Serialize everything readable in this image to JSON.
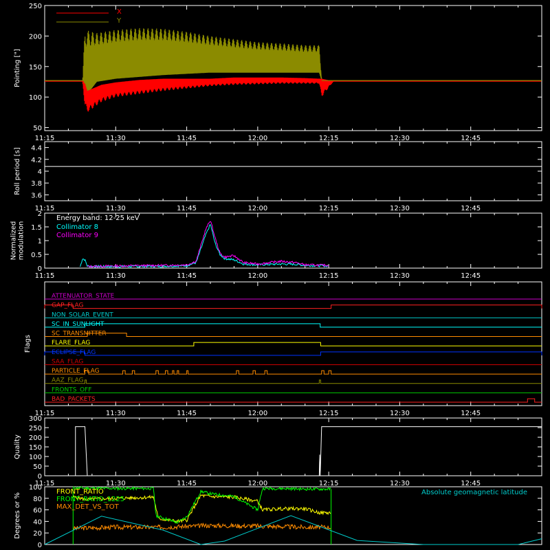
{
  "chart_data": [
    {
      "type": "line",
      "ylabel": "Pointing [\"]",
      "ylim": [
        45,
        250
      ],
      "yticks": [
        50,
        100,
        150,
        200,
        250
      ],
      "xticks": [
        "11:15",
        "11:30",
        "11:45",
        "12:00",
        "12:15",
        "12:30",
        "12:45"
      ],
      "xlim_minutes": [
        675,
        780
      ],
      "series": [
        {
          "name": "X",
          "color": "#ff0000",
          "x": [
            675,
            683,
            683.5,
            684,
            687,
            690,
            695,
            700,
            705,
            710,
            715,
            720,
            725,
            730,
            733,
            733.5,
            736,
            780
          ],
          "low": [
            126,
            126,
            85,
            75,
            92,
            100,
            105,
            110,
            114,
            118,
            120,
            121,
            122,
            122,
            122,
            100,
            126,
            126
          ],
          "high": [
            126,
            126,
            122,
            110,
            120,
            124,
            128,
            130,
            130,
            130,
            132,
            132,
            132,
            131,
            130,
            130,
            126,
            126
          ]
        },
        {
          "name": "Y",
          "color": "#8b8b00",
          "x": [
            675,
            683,
            683.5,
            686,
            690,
            695,
            700,
            705,
            710,
            715,
            720,
            725,
            730,
            733,
            733.5,
            780
          ],
          "low": [
            127,
            127,
            100,
            125,
            130,
            133,
            136,
            138,
            140,
            140,
            140,
            140,
            140,
            140,
            127,
            127
          ],
          "high": [
            127,
            127,
            210,
            205,
            210,
            213,
            212,
            207,
            200,
            195,
            190,
            188,
            185,
            185,
            127,
            127
          ]
        }
      ]
    },
    {
      "type": "line",
      "ylabel": "Roll period [s]",
      "ylim": [
        3.5,
        4.5
      ],
      "yticks": [
        3.6,
        3.8,
        4.0,
        4.2,
        4.4
      ],
      "series": [
        {
          "name": "",
          "color": "#ffffff",
          "x": [
            675,
            780
          ],
          "values": [
            4.08,
            4.08
          ]
        }
      ]
    },
    {
      "type": "line",
      "ylabel": "Normalized modulation",
      "ylim": [
        0,
        2.0
      ],
      "yticks": [
        0.0,
        0.5,
        1.0,
        1.5,
        2.0
      ],
      "annotation": "Energy band: 12-25 keV",
      "series": [
        {
          "name": "Collimator 8",
          "color": "#00ffff",
          "x": [
            682.5,
            683,
            683.5,
            684,
            685,
            690,
            700,
            705,
            707,
            709,
            710,
            711,
            712,
            713,
            715,
            717,
            720,
            725,
            728,
            730,
            735
          ],
          "values": [
            0.05,
            0.35,
            0.3,
            0.08,
            0.06,
            0.06,
            0.07,
            0.09,
            0.2,
            1.2,
            1.6,
            0.9,
            0.5,
            0.35,
            0.3,
            0.15,
            0.12,
            0.15,
            0.14,
            0.1,
            0.08
          ]
        },
        {
          "name": "Collimator 9",
          "color": "#ff00ff",
          "x": [
            684,
            690,
            700,
            705,
            707,
            709,
            710,
            711,
            712,
            713,
            715,
            717,
            720,
            725,
            728,
            730,
            735
          ],
          "values": [
            0.06,
            0.08,
            0.1,
            0.12,
            0.25,
            1.4,
            1.75,
            1.1,
            0.55,
            0.4,
            0.45,
            0.2,
            0.15,
            0.25,
            0.2,
            0.12,
            0.1
          ]
        }
      ]
    },
    {
      "type": "line",
      "ylabel": "Flags",
      "flags": [
        {
          "label": "ATTENUATOR_STATE",
          "color": "#cc00cc",
          "on": []
        },
        {
          "label": "GAP_FLAG",
          "color": "#ff2020",
          "on": [
            [
              675,
              681
            ],
            [
              735.5,
              780
            ]
          ]
        },
        {
          "label": "NON_SOLAR_EVENT",
          "color": "#00cccc",
          "on": []
        },
        {
          "label": "SC_IN_SUNLIGHT",
          "color": "#00ffff",
          "on": [
            [
              683.5,
              733.2
            ]
          ]
        },
        {
          "label": "SC_TRANSMITTER",
          "color": "#ff8c00",
          "on": [
            [
              684,
              692.3
            ]
          ]
        },
        {
          "label": "FLARE_FLAG",
          "color": "#ffff00",
          "on": [
            [
              706.5,
              733.3
            ]
          ]
        },
        {
          "label": "ECLIPSE_FLAG",
          "color": "#0033ff",
          "on": [
            [
              675,
              683.5
            ],
            [
              733.3,
              780
            ]
          ]
        },
        {
          "label": "SAA_FLAG",
          "color": "#cc0000",
          "on": []
        },
        {
          "label": "PARTICLE_FLAG",
          "color": "#ff8c00",
          "on": [
            [
              683.5,
              684.3
            ],
            [
              691.5,
              692
            ],
            [
              693.5,
              694
            ],
            [
              698.5,
              699
            ],
            [
              700.5,
              701
            ],
            [
              702,
              702.3
            ],
            [
              703,
              703.3
            ],
            [
              705,
              705.3
            ],
            [
              715.5,
              716
            ],
            [
              719,
              719.5
            ],
            [
              721.5,
              722
            ],
            [
              733.5,
              734
            ],
            [
              735,
              735.5
            ]
          ]
        },
        {
          "label": "AAZ_FLAG",
          "color": "#8b8b00",
          "on": [
            [
              683.5,
              683.8
            ],
            [
              733,
              733.3
            ]
          ]
        },
        {
          "label": "FRONTS_OFF",
          "color": "#00cc00",
          "on": []
        },
        {
          "label": "BAD_PACKETS",
          "color": "#ff2020",
          "on": [
            [
              777,
              778.5
            ]
          ]
        }
      ]
    },
    {
      "type": "line",
      "ylabel": "Quality",
      "ylim": [
        0,
        300
      ],
      "yticks": [
        0,
        50,
        100,
        150,
        200,
        250,
        300
      ],
      "series": [
        {
          "name": "",
          "color": "#ffffff",
          "x": [
            675,
            681,
            682,
            683.5,
            684,
            733,
            733.2,
            733.5,
            735,
            780
          ],
          "values": [
            0,
            0,
            255,
            255,
            0,
            0,
            110,
            255,
            255,
            255
          ]
        }
      ]
    },
    {
      "type": "line",
      "ylabel": "Degrees or %",
      "ylim": [
        0,
        100
      ],
      "yticks": [
        0,
        20,
        40,
        60,
        80,
        100
      ],
      "annotation": "Absolute geomagnetic latitude",
      "series": [
        {
          "name": "FRONT_RATIO",
          "color": "#ffff00",
          "x": [
            681,
            684,
            690,
            698,
            699,
            703,
            705,
            708,
            710,
            715,
            720,
            721,
            725,
            730,
            733,
            735.5
          ],
          "values": [
            82,
            78,
            80,
            82,
            45,
            40,
            42,
            85,
            83,
            82,
            75,
            60,
            62,
            62,
            55,
            55
          ]
        },
        {
          "name": "FRONT_RATIO_1225",
          "color": "#00ff00",
          "x": [
            681,
            690,
            698,
            698.5,
            703,
            705,
            708,
            710,
            715,
            720,
            721,
            725,
            730,
            735.5
          ],
          "values": [
            98,
            97,
            97,
            50,
            38,
            48,
            92,
            88,
            83,
            60,
            97,
            97,
            96,
            96
          ]
        },
        {
          "name": "MAX_DET_VS_TOT",
          "color": "#ff8c00",
          "x": [
            681,
            690,
            700,
            710,
            720,
            730,
            735.5
          ],
          "values": [
            28,
            30,
            30,
            33,
            32,
            30,
            30
          ]
        },
        {
          "name": "Absolute geomagnetic latitude",
          "color": "#00cccc",
          "x": [
            675,
            687,
            700,
            708,
            713,
            727,
            741,
            755,
            775,
            780
          ],
          "values": [
            0,
            49,
            25,
            0,
            6,
            50,
            7,
            0,
            0,
            10
          ]
        }
      ]
    }
  ]
}
